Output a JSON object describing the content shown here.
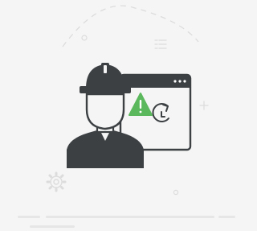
{
  "illustration": {
    "subject": "worker-with-warning-window",
    "icons": [
      "hard-hat-worker-icon",
      "browser-window-icon",
      "warning-triangle-icon",
      "refresh-icon",
      "gear-icon",
      "list-icon",
      "plus-icon"
    ]
  },
  "colors": {
    "background": "#f5f5f5",
    "ink": "#3c4043",
    "accent": "#5cb85c",
    "decoration": "#dcdcdc",
    "placeholder_bar": "#e6e6e6"
  }
}
